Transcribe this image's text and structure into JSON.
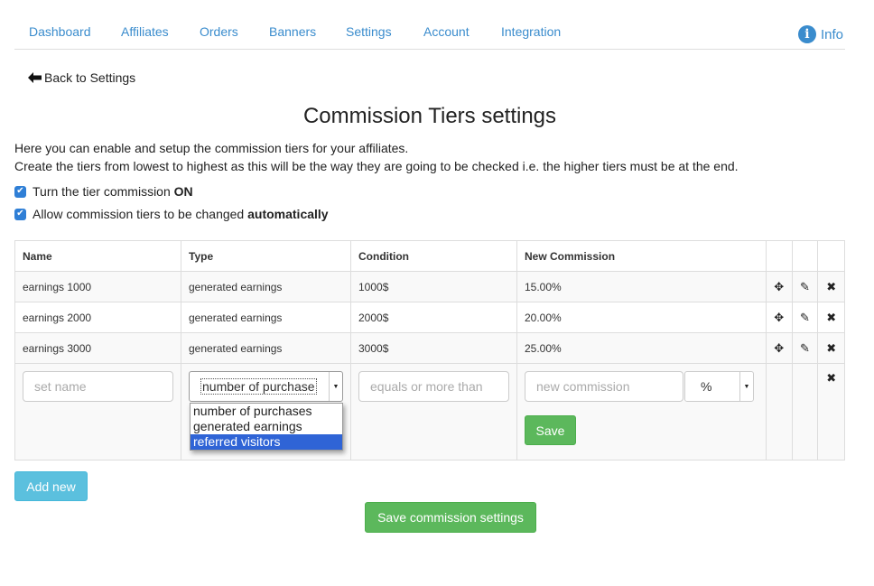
{
  "nav": {
    "items": [
      "Dashboard",
      "Affiliates",
      "Orders",
      "Banners",
      "Settings",
      "Account",
      "Integration"
    ],
    "info_label": "Info"
  },
  "back_link": "Back to Settings",
  "page_title": "Commission Tiers settings",
  "intro": {
    "line1": "Here you can enable and setup the commission tiers for your affiliates.",
    "line2": "Create the tiers from lowest to highest as this will be the way they are going to be checked i.e. the higher tiers must be at the end."
  },
  "options": {
    "tier_on": {
      "text": "Turn the tier commission ",
      "bold": "ON",
      "checked": true
    },
    "auto_change": {
      "text": "Allow commission tiers to be changed ",
      "bold": "automatically",
      "checked": true
    }
  },
  "table": {
    "headers": [
      "Name",
      "Type",
      "Condition",
      "New Commission"
    ],
    "rows": [
      {
        "name": "earnings 1000",
        "type": "generated earnings",
        "condition": "1000$",
        "commission": "15.00%"
      },
      {
        "name": "earnings 2000",
        "type": "generated earnings",
        "condition": "2000$",
        "commission": "20.00%"
      },
      {
        "name": "earnings 3000",
        "type": "generated earnings",
        "condition": "3000$",
        "commission": "25.00%"
      }
    ]
  },
  "new_tier": {
    "name_placeholder": "set name",
    "type_value": "number of purchase",
    "type_options": [
      "number of purchases",
      "generated earnings",
      "referred visitors"
    ],
    "type_highlighted": "referred visitors",
    "condition_placeholder": "equals or more than",
    "commission_placeholder": "new commission",
    "unit_value": "%",
    "save_label": "Save"
  },
  "add_new_label": "Add new",
  "save_settings_label": "Save commission settings",
  "colors": {
    "link": "#3a8ccd",
    "success": "#5cb85c",
    "info_button": "#5bc0de",
    "highlight": "#2f64d6"
  },
  "icons": [
    "info-icon",
    "arrow-left-icon",
    "move-icon",
    "pencil-icon",
    "close-icon",
    "checkbox-icon",
    "caret-down-icon"
  ]
}
